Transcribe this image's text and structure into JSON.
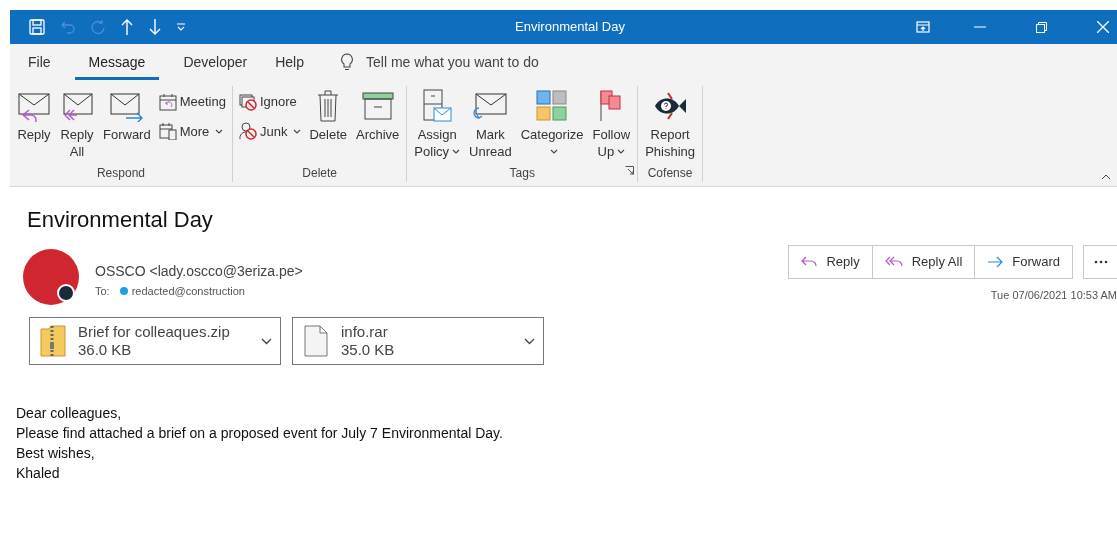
{
  "window": {
    "title": "Environmental Day"
  },
  "tabs": [
    {
      "label": "File",
      "selected": false
    },
    {
      "label": "Message",
      "selected": true
    },
    {
      "label": "Developer",
      "selected": false
    },
    {
      "label": "Help",
      "selected": false
    }
  ],
  "tell_me": {
    "placeholder": "Tell me what you want to do"
  },
  "ribbon": [
    {
      "name": "Respond",
      "launcher": false,
      "items": [
        {
          "kind": "large",
          "lines": [
            "Reply"
          ],
          "dropdown": false
        },
        {
          "kind": "large",
          "lines": [
            "Reply",
            "All"
          ],
          "dropdown": false
        },
        {
          "kind": "large",
          "lines": [
            "Forward"
          ],
          "dropdown": false
        },
        {
          "kind": "stack",
          "items": [
            {
              "label": "Meeting",
              "dropdown": false
            },
            {
              "label": "More",
              "dropdown": true
            }
          ]
        }
      ]
    },
    {
      "name": "Delete",
      "launcher": false,
      "items": [
        {
          "kind": "stack",
          "items": [
            {
              "label": "Ignore",
              "dropdown": false
            },
            {
              "label": "Junk",
              "dropdown": true
            }
          ]
        },
        {
          "kind": "large",
          "lines": [
            "Delete"
          ],
          "dropdown": false
        },
        {
          "kind": "large",
          "lines": [
            "Archive"
          ],
          "dropdown": false
        }
      ]
    },
    {
      "name": "Tags",
      "launcher": true,
      "items": [
        {
          "kind": "large",
          "lines": [
            "Assign",
            "Policy"
          ],
          "dropdown": true
        },
        {
          "kind": "large",
          "lines": [
            "Mark",
            "Unread"
          ],
          "dropdown": false
        },
        {
          "kind": "large",
          "lines": [
            "Categorize"
          ],
          "dropdown": true
        },
        {
          "kind": "large",
          "lines": [
            "Follow",
            "Up"
          ],
          "dropdown": true
        }
      ]
    },
    {
      "name": "Cofense",
      "launcher": false,
      "items": [
        {
          "kind": "large",
          "lines": [
            "Report",
            "Phishing"
          ],
          "dropdown": false
        }
      ]
    }
  ],
  "message": {
    "subject": "Environmental Day",
    "sender": "OSSCO <lady.oscco@3eriza.pe>",
    "to_label": "To:",
    "recipient": "redacted@construction",
    "actions": [
      {
        "label": "Reply"
      },
      {
        "label": "Reply All"
      },
      {
        "label": "Forward"
      }
    ],
    "date": "Tue 07/06/2021 10:53 AM",
    "attachments": [
      {
        "kind": "zip",
        "name": "Brief for colleaques.zip",
        "size": "36.0 KB"
      },
      {
        "kind": "file",
        "name": "info.rar",
        "size": "35.0 KB"
      }
    ],
    "body": [
      "Dear colleagues,",
      "Please find attached a brief on a proposed event for July 7 Environmental Day.",
      "Best wishes,",
      "Khaled"
    ]
  }
}
